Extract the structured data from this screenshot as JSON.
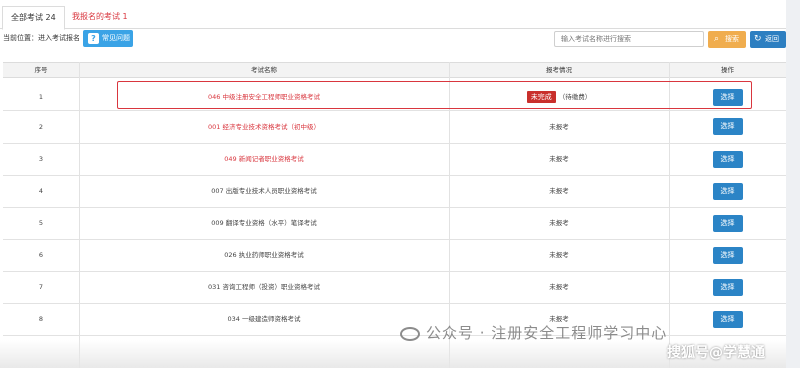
{
  "tabs": [
    {
      "label": "全部考试 24"
    },
    {
      "label": "我报名的考试 1"
    }
  ],
  "breadcrumb": "当前位置：进入考试报名",
  "help_button": {
    "label": "常见问题",
    "icon": "help-icon"
  },
  "search": {
    "placeholder": "输入考试名称进行搜索",
    "button_label": "搜索",
    "button_icon": "search-icon"
  },
  "back_button": {
    "label": "返回",
    "icon": "refresh-icon"
  },
  "table": {
    "headers": [
      "序号",
      "考试名称",
      "报考情况",
      "操作"
    ],
    "rows": [
      {
        "idx": "1",
        "name": "046 中级注册安全工程师职业资格考试",
        "status": "未完成",
        "status_note": "（待缴费）",
        "action": "选择"
      },
      {
        "idx": "2",
        "name": "001 经济专业技术资格考试（初中级）",
        "status": "未报考",
        "action": "选择"
      },
      {
        "idx": "3",
        "name": "049 新闻记者职业资格考试",
        "status": "未报考",
        "action": "选择"
      },
      {
        "idx": "4",
        "name": "007 出版专业技术人员职业资格考试",
        "status": "未报考",
        "action": "选择"
      },
      {
        "idx": "5",
        "name": "009 翻译专业资格（水平）笔译考试",
        "status": "未报考",
        "action": "选择"
      },
      {
        "idx": "6",
        "name": "026 执业药师职业资格考试",
        "status": "未报考",
        "action": "选择"
      },
      {
        "idx": "7",
        "name": "031 咨询工程师（投资）职业资格考试",
        "status": "未报考",
        "action": "选择"
      },
      {
        "idx": "8",
        "name": "034 一级建造师资格考试",
        "status": "未报考",
        "action": "选择"
      }
    ]
  },
  "colors": {
    "accent": "#2b84c6",
    "danger": "#c9302c",
    "warning": "#f0ad4e"
  },
  "watermark": {
    "text1": "公众号 · 注册安全工程师学习中心",
    "text2": "搜狐号@学慧通"
  }
}
